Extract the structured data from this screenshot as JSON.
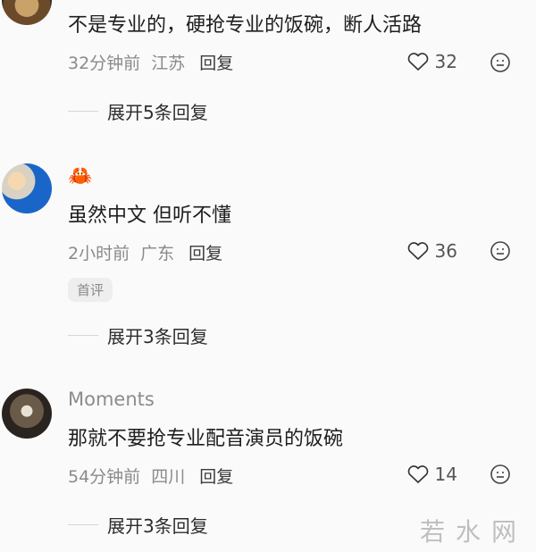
{
  "comments": [
    {
      "text": "不是专业的，硬抢专业的饭碗，断人活路",
      "time": "32分钟前",
      "location": "江苏",
      "reply_label": "回复",
      "likes": "32",
      "expand": "展开5条回复"
    },
    {
      "username_emoji": "🦀",
      "text": "虽然中文 但听不懂",
      "time": "2小时前",
      "location": "广东",
      "reply_label": "回复",
      "likes": "36",
      "badge": "首评",
      "expand": "展开3条回复"
    },
    {
      "username": "Moments",
      "text": "那就不要抢专业配音演员的饭碗",
      "time": "54分钟前",
      "location": "四川",
      "reply_label": "回复",
      "likes": "14",
      "expand": "展开3条回复"
    }
  ],
  "watermark": "若水网"
}
